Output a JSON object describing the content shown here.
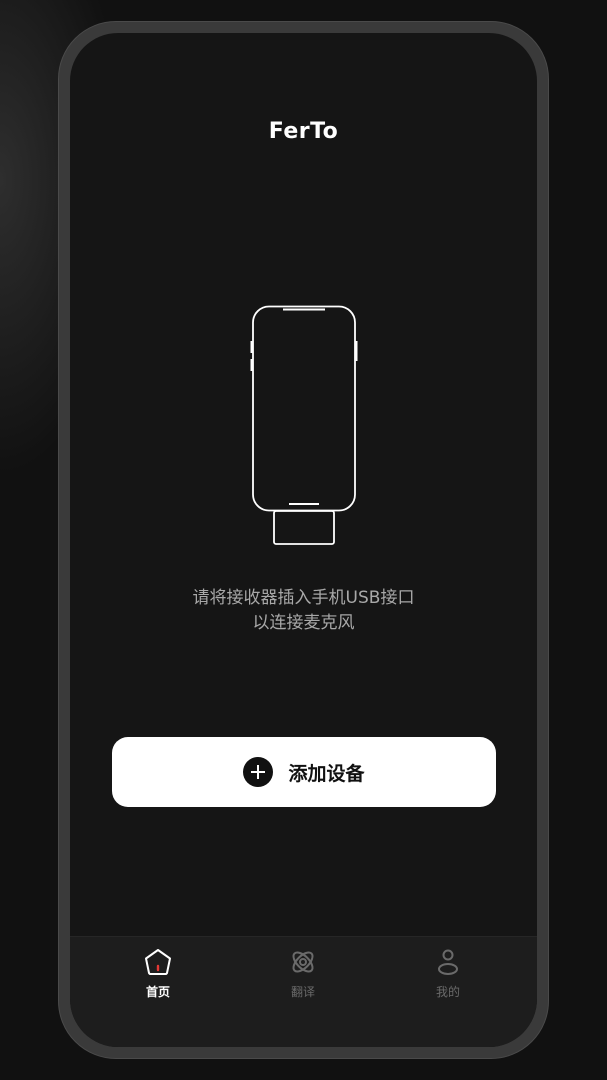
{
  "app": {
    "title": "FerTo"
  },
  "main": {
    "hint_line1": "请将接收器插入手机USB接口",
    "hint_line2": "以连接麦克风",
    "add_button_label": "添加设备"
  },
  "tabbar": {
    "tabs": [
      {
        "label": "首页",
        "icon": "home-icon",
        "active": true
      },
      {
        "label": "翻译",
        "icon": "translate-icon",
        "active": false
      },
      {
        "label": "我的",
        "icon": "profile-icon",
        "active": false
      }
    ]
  },
  "colors": {
    "background": "#111111",
    "screen": "#151515",
    "accent_dot": "#e53935",
    "button_bg": "#ffffff"
  }
}
